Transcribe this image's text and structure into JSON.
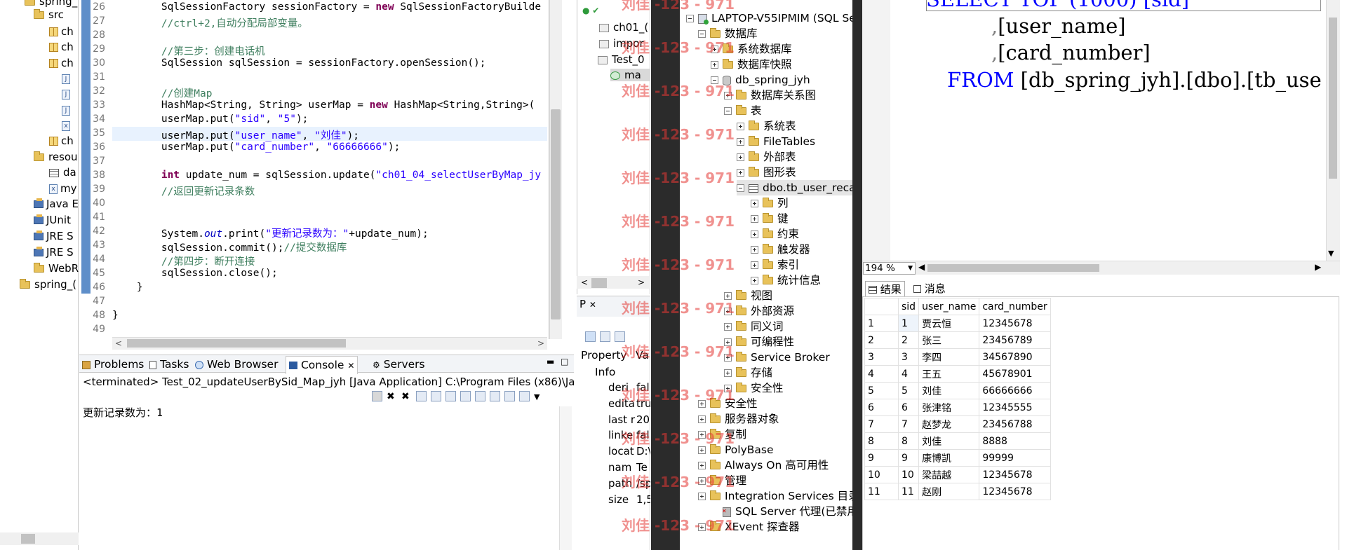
{
  "package_explorer": {
    "items": [
      {
        "label": "spring_",
        "kind": "project"
      },
      {
        "label": "src",
        "kind": "folder"
      },
      {
        "label": "ch",
        "kind": "package"
      },
      {
        "label": "ch",
        "kind": "package"
      },
      {
        "label": "ch",
        "kind": "package"
      },
      {
        "label": "",
        "kind": "java"
      },
      {
        "label": "",
        "kind": "java"
      },
      {
        "label": "",
        "kind": "java"
      },
      {
        "label": "",
        "kind": "xml"
      },
      {
        "label": "ch",
        "kind": "package"
      },
      {
        "label": "resou",
        "kind": "folder"
      },
      {
        "label": "da",
        "kind": "file"
      },
      {
        "label": "my",
        "kind": "xml"
      },
      {
        "label": "Java E",
        "kind": "lib"
      },
      {
        "label": "JUnit",
        "kind": "lib"
      },
      {
        "label": "JRE S",
        "kind": "lib"
      },
      {
        "label": "JRE S",
        "kind": "lib"
      },
      {
        "label": "WebR",
        "kind": "folder"
      },
      {
        "label": "spring_(",
        "kind": "project"
      }
    ]
  },
  "editor": {
    "lines": [
      {
        "n": "26",
        "segments": [
          {
            "t": "        SqlSessionFactory sessionFactory = ",
            "c": ""
          },
          {
            "t": "new",
            "c": "kw"
          },
          {
            "t": " SqlSessionFactoryBuilde",
            "c": ""
          }
        ]
      },
      {
        "n": "27",
        "segments": [
          {
            "t": "        //ctrl+2,自动分配局部变量。",
            "c": "cm"
          }
        ]
      },
      {
        "n": "28",
        "segments": []
      },
      {
        "n": "29",
        "segments": [
          {
            "t": "        //第三步：创建电话机",
            "c": "cm"
          }
        ]
      },
      {
        "n": "30",
        "segments": [
          {
            "t": "        SqlSession sqlSession = sessionFactory.openSession();",
            "c": ""
          }
        ]
      },
      {
        "n": "31",
        "segments": []
      },
      {
        "n": "32",
        "segments": [
          {
            "t": "        //创建Map",
            "c": "cm"
          }
        ]
      },
      {
        "n": "33",
        "segments": [
          {
            "t": "        HashMap<String, String> userMap = ",
            "c": ""
          },
          {
            "t": "new",
            "c": "kw"
          },
          {
            "t": " HashMap<String,String>(",
            "c": ""
          }
        ]
      },
      {
        "n": "34",
        "segments": [
          {
            "t": "        userMap.put(",
            "c": ""
          },
          {
            "t": "\"sid\"",
            "c": "str"
          },
          {
            "t": ", ",
            "c": ""
          },
          {
            "t": "\"5\"",
            "c": "str"
          },
          {
            "t": ");",
            "c": ""
          }
        ]
      },
      {
        "n": "35",
        "segments": [
          {
            "t": "        userMap.put(",
            "c": ""
          },
          {
            "t": "\"user_name\"",
            "c": "str"
          },
          {
            "t": ", ",
            "c": ""
          },
          {
            "t": "\"刘佳\"",
            "c": "str"
          },
          {
            "t": ");",
            "c": ""
          }
        ]
      },
      {
        "n": "36",
        "segments": [
          {
            "t": "        userMap.put(",
            "c": ""
          },
          {
            "t": "\"card_number\"",
            "c": "str"
          },
          {
            "t": ", ",
            "c": ""
          },
          {
            "t": "\"66666666\"",
            "c": "str"
          },
          {
            "t": ");",
            "c": ""
          }
        ]
      },
      {
        "n": "37",
        "segments": []
      },
      {
        "n": "38",
        "segments": [
          {
            "t": "        ",
            "c": ""
          },
          {
            "t": "int",
            "c": "kw"
          },
          {
            "t": " update_num = sqlSession.update(",
            "c": ""
          },
          {
            "t": "\"ch01_04_selectUserByMap_jy",
            "c": "str"
          }
        ]
      },
      {
        "n": "39",
        "segments": [
          {
            "t": "        //返回更新记录条数",
            "c": "cm"
          }
        ]
      },
      {
        "n": "40",
        "segments": []
      },
      {
        "n": "41",
        "segments": []
      },
      {
        "n": "42",
        "segments": [
          {
            "t": "        System.",
            "c": ""
          },
          {
            "t": "out",
            "c": "it"
          },
          {
            "t": ".print(",
            "c": ""
          },
          {
            "t": "\"更新记录数为：\"",
            "c": "str"
          },
          {
            "t": "+update_num);",
            "c": ""
          }
        ]
      },
      {
        "n": "43",
        "segments": [
          {
            "t": "        sqlSession.commit();",
            "c": ""
          },
          {
            "t": "//提交数据库",
            "c": "cm"
          }
        ]
      },
      {
        "n": "44",
        "segments": [
          {
            "t": "        //第四步：断开连接",
            "c": "cm"
          }
        ]
      },
      {
        "n": "45",
        "segments": [
          {
            "t": "        sqlSession.close();",
            "c": ""
          }
        ]
      },
      {
        "n": "46",
        "segments": [
          {
            "t": "    }",
            "c": ""
          }
        ]
      },
      {
        "n": "47",
        "segments": []
      },
      {
        "n": "48",
        "segments": [
          {
            "t": "}",
            "c": ""
          }
        ]
      },
      {
        "n": "49",
        "segments": []
      }
    ]
  },
  "console": {
    "tabs": [
      "Problems",
      "Tasks",
      "Web Browser",
      "Console",
      "Servers"
    ],
    "active_tab": "Console",
    "status": "<terminated> Test_02_updateUserBySid_Map_jyh [Java Application] C:\\Program Files (x86)\\Java\\",
    "output": "更新记录数为：1"
  },
  "outline": {
    "items": [
      "ch01_(",
      "impor",
      "Test_0",
      "ma"
    ]
  },
  "properties": {
    "tab_label": "P",
    "header_key": "Property",
    "header_val": "Va",
    "group": "Info",
    "rows": [
      {
        "k": "deri",
        "v": "fal"
      },
      {
        "k": "edita",
        "v": "tru"
      },
      {
        "k": "last r",
        "v": "20"
      },
      {
        "k": "linke",
        "v": "fal"
      },
      {
        "k": "locat",
        "v": "D:\\"
      },
      {
        "k": "nam",
        "v": "Te"
      },
      {
        "k": "path",
        "v": "/sp"
      },
      {
        "k": "size",
        "v": "1,5"
      }
    ]
  },
  "object_explorer": {
    "server": "LAPTOP-V55IPMIM (SQL Ser",
    "databases": "数据库",
    "system_databases": "系统数据库",
    "db_snapshots": "数据库快照",
    "db": "db_spring_jyh",
    "db_diagrams": "数据库关系图",
    "tables": "表",
    "table_children": [
      "系统表",
      "FileTables",
      "外部表",
      "图形表"
    ],
    "table": "dbo.tb_user_reca",
    "table_children2": [
      "列",
      "键",
      "约束",
      "触发器",
      "索引",
      "统计信息"
    ],
    "db_children": [
      "视图",
      "外部资源",
      "同义词",
      "可编程性",
      "Service Broker",
      "存储",
      "安全性"
    ],
    "server_children": [
      "安全性",
      "服务器对象",
      "复制",
      "PolyBase",
      "Always On 高可用性",
      "管理",
      "Integration Services 目录"
    ],
    "agent": "SQL Server 代理(已禁用代理",
    "xevent": "XEvent 探查器"
  },
  "sql_editor": {
    "line0": "SELECT TOP (1000) [sid]",
    "line1": ",[user_name]",
    "line2": ",[card_number]",
    "from_kw": "FROM",
    "from_rest": " [db_spring_jyh].[dbo].[tb_use",
    "zoom": "194 %"
  },
  "results": {
    "tabs": [
      "结果",
      "消息"
    ],
    "columns": [
      "sid",
      "user_name",
      "card_number"
    ],
    "rows": [
      [
        "1",
        "1",
        "贾云恒",
        "12345678"
      ],
      [
        "2",
        "2",
        "张三",
        "23456789"
      ],
      [
        "3",
        "3",
        "李四",
        "34567890"
      ],
      [
        "4",
        "4",
        "王五",
        "45678901"
      ],
      [
        "5",
        "5",
        "刘佳",
        "66666666"
      ],
      [
        "6",
        "6",
        "张津铭",
        "12345555"
      ],
      [
        "7",
        "7",
        "赵梦龙",
        "23456788"
      ],
      [
        "8",
        "8",
        "刘佳",
        "8888"
      ],
      [
        "9",
        "9",
        "康博凯",
        "99999"
      ],
      [
        "10",
        "10",
        "梁喆越",
        "12345678"
      ],
      [
        "11",
        "11",
        "赵刚",
        "12345678"
      ]
    ]
  },
  "watermark": "刘佳 -123 - 971"
}
